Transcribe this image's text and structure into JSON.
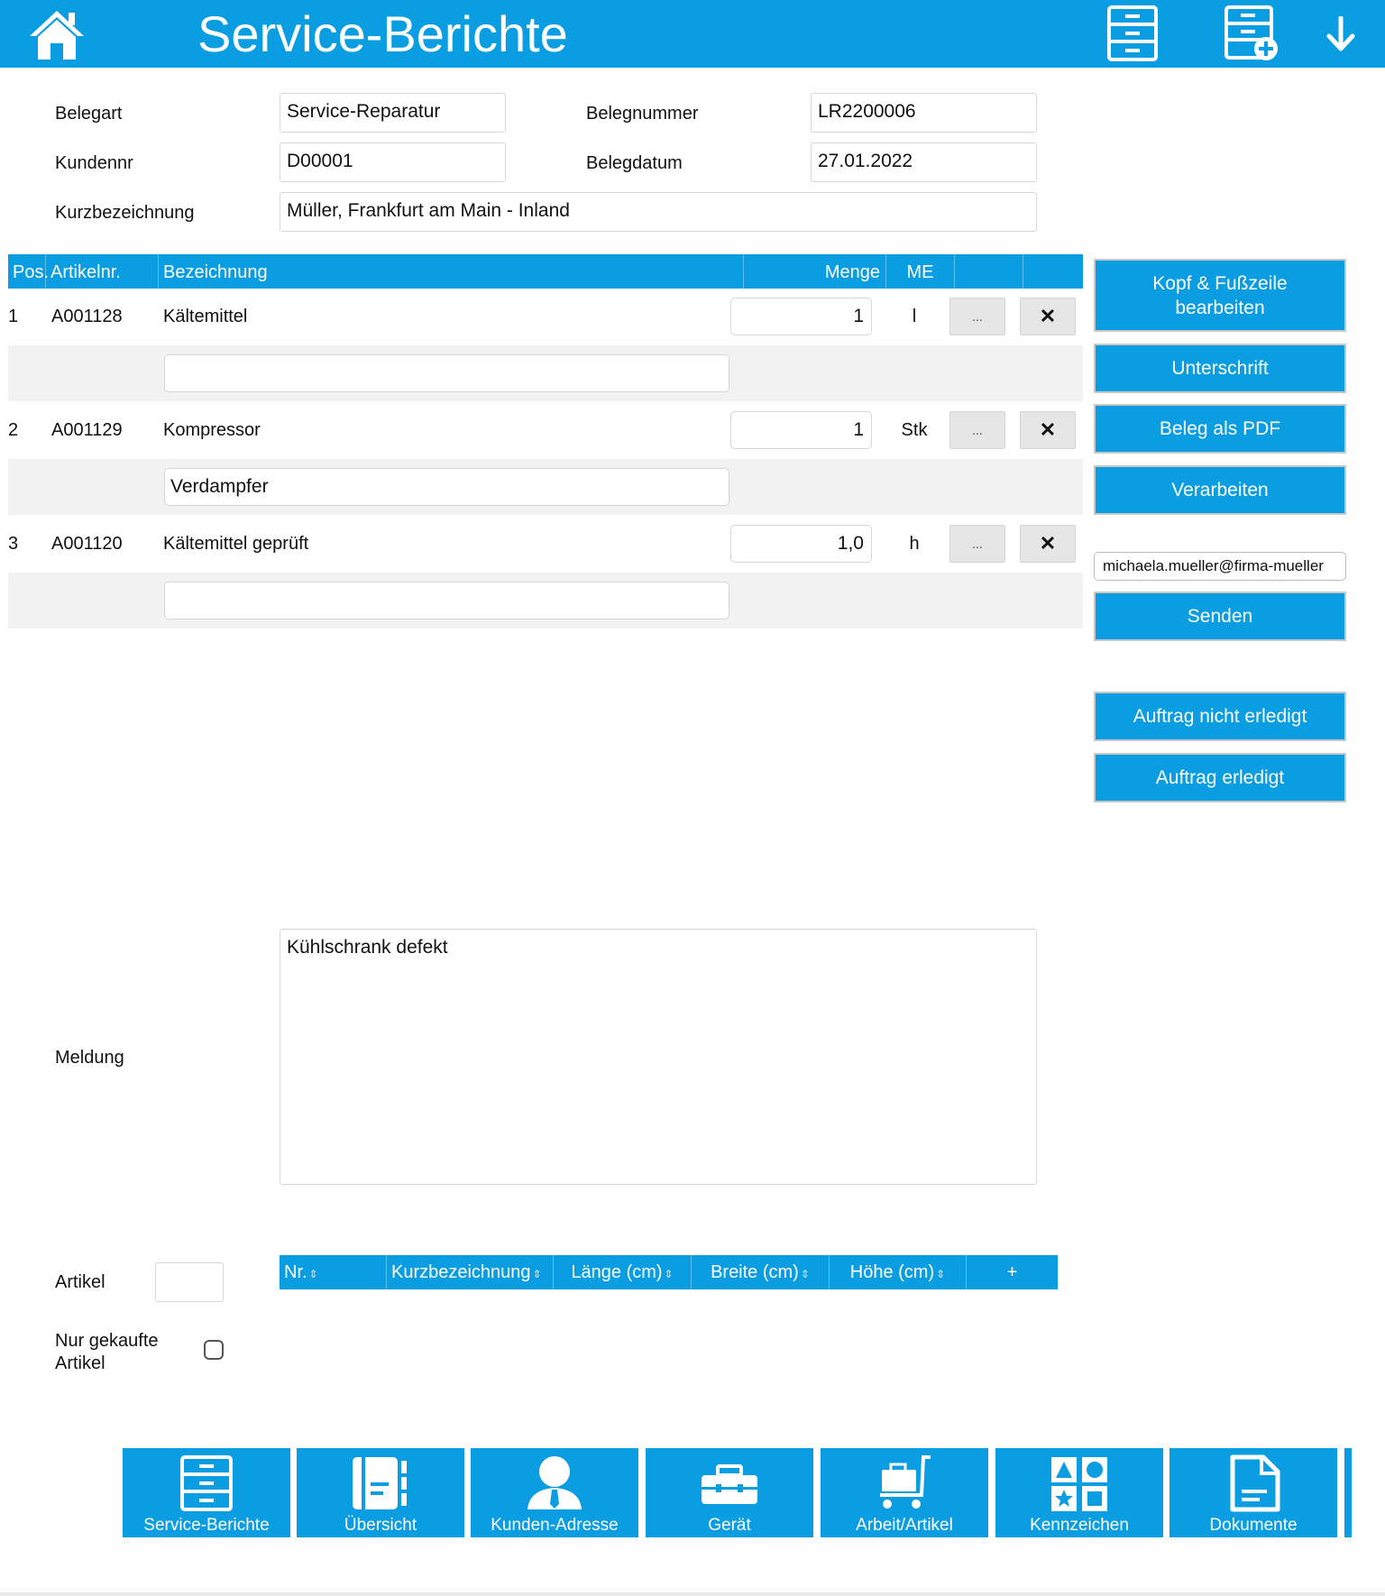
{
  "header": {
    "title": "Service-Berichte",
    "icons": [
      "home-icon",
      "cabinet-icon",
      "cabinet-add-icon",
      "arrow-down-icon"
    ]
  },
  "form": {
    "belegart_label": "Belegart",
    "belegart_value": "Service-Reparatur",
    "belegnummer_label": "Belegnummer",
    "belegnummer_value": "LR2200006",
    "kundennr_label": "Kundennr",
    "kundennr_value": "D00001",
    "belegdatum_label": "Belegdatum",
    "belegdatum_value": "27.01.2022",
    "kurz_label": "Kurzbezeichnung",
    "kurz_value": "Müller, Frankfurt am Main - Inland"
  },
  "table": {
    "headers": {
      "pos": "Pos.",
      "artikelnr": "Artikelnr.",
      "bezeichnung": "Bezeichnung",
      "menge": "Menge",
      "me": "ME"
    },
    "rows": [
      {
        "pos": "1",
        "artikelnr": "A001128",
        "bezeichnung": "Kältemittel",
        "menge": "1",
        "me": "l",
        "note": "",
        "more": "...",
        "delete": "✕"
      },
      {
        "pos": "2",
        "artikelnr": "A001129",
        "bezeichnung": "Kompressor",
        "menge": "1",
        "me": "Stk",
        "note": "Verdampfer",
        "more": "...",
        "delete": "✕"
      },
      {
        "pos": "3",
        "artikelnr": "A001120",
        "bezeichnung": "Kältemittel geprüft",
        "menge": "1,0",
        "me": "h",
        "note": "",
        "more": "...",
        "delete": "✕"
      }
    ]
  },
  "side": {
    "kopf_line1": "Kopf & Fußzeile",
    "kopf_line2": "bearbeiten",
    "unterschrift": "Unterschrift",
    "pdf": "Beleg als PDF",
    "verarbeiten": "Verarbeiten",
    "email": "michaela.mueller@firma-mueller",
    "senden": "Senden",
    "nicht_erledigt": "Auftrag nicht erledigt",
    "erledigt": "Auftrag erledigt"
  },
  "meldung": {
    "label": "Meldung",
    "value": "Kühlschrank defekt"
  },
  "artikel": {
    "label": "Artikel",
    "value": "",
    "nur_gekauft_line1": "Nur gekaufte",
    "nur_gekauft_line2": "Artikel",
    "nur_gekauft_checked": false,
    "columns": [
      "Nr.",
      "Kurzbezeichnung",
      "Länge (cm)",
      "Breite (cm)",
      "Höhe (cm)",
      "+"
    ]
  },
  "bottom_nav": [
    {
      "label": "Service-Berichte",
      "icon": "cabinet-icon"
    },
    {
      "label": "Übersicht",
      "icon": "notebook-icon"
    },
    {
      "label": "Kunden-Adresse",
      "icon": "person-icon"
    },
    {
      "label": "Gerät",
      "icon": "toolbox-icon"
    },
    {
      "label": "Arbeit/Artikel",
      "icon": "cart-icon"
    },
    {
      "label": "Kennzeichen",
      "icon": "shapes-icon"
    },
    {
      "label": "Dokumente",
      "icon": "document-icon"
    }
  ],
  "colors": {
    "accent": "#0a9de2",
    "row_alt": "#f2f2f2"
  }
}
